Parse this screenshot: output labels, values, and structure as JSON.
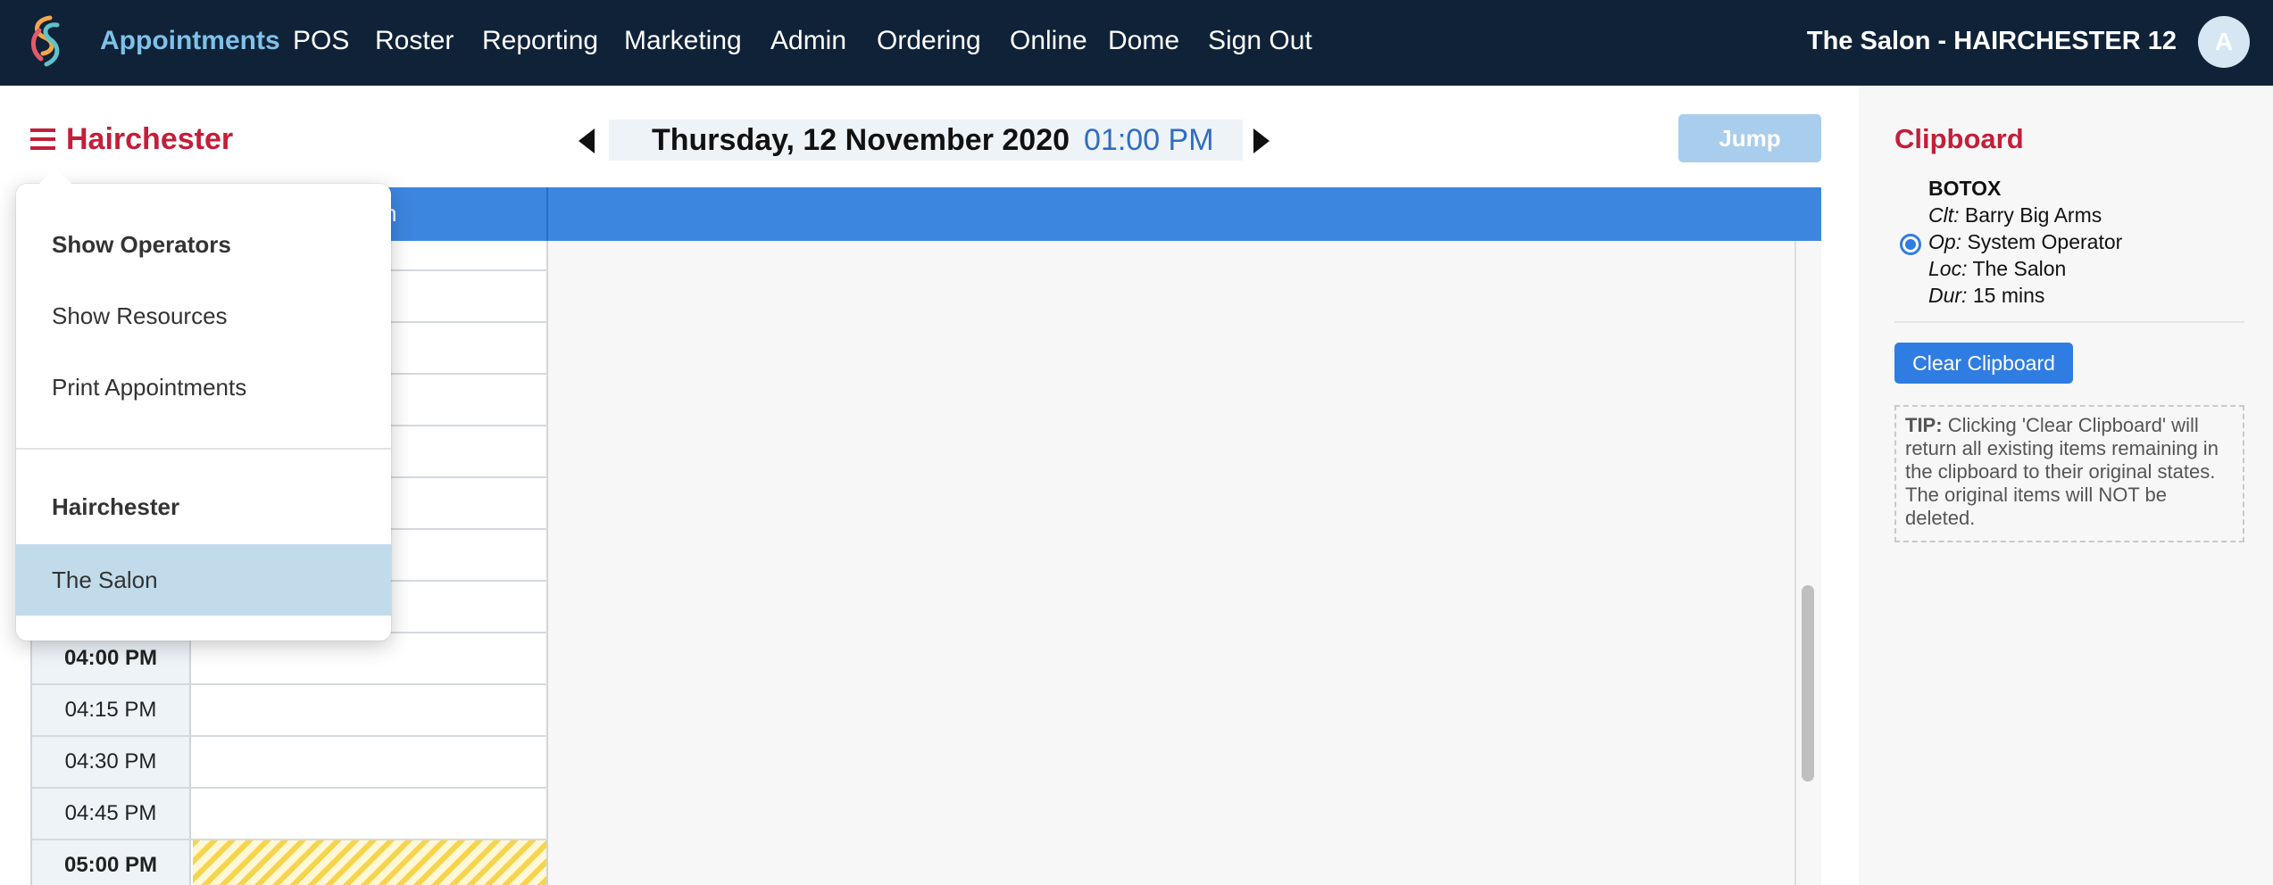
{
  "nav": {
    "items": [
      "Appointments",
      "POS",
      "Roster",
      "Reporting",
      "Marketing",
      "Admin",
      "Ordering",
      "Online",
      "Dome",
      "Sign Out"
    ],
    "active": "Appointments",
    "tenant": "The Salon - HAIRCHESTER 12",
    "avatar_initial": "A"
  },
  "location_title": "Hairchester",
  "date_nav": {
    "date": "Thursday, 12 November 2020",
    "time": "01:00 PM",
    "jump_label": "Jump"
  },
  "calendar": {
    "column_label_partial": "n",
    "time_slots": [
      {
        "label": "04:00 PM",
        "hour": true,
        "booked": false
      },
      {
        "label": "04:15 PM",
        "hour": false,
        "booked": false
      },
      {
        "label": "04:30 PM",
        "hour": false,
        "booked": false
      },
      {
        "label": "04:45 PM",
        "hour": false,
        "booked": false
      },
      {
        "label": "05:00 PM",
        "hour": true,
        "booked": true
      }
    ]
  },
  "menu": {
    "show_operators": "Show Operators",
    "show_resources": "Show Resources",
    "print_appointments": "Print Appointments",
    "section_heading": "Hairchester",
    "selected_location": "The Salon"
  },
  "clipboard": {
    "title": "Clipboard",
    "item": {
      "service": "BOTOX",
      "client_label": "Clt:",
      "client": "Barry Big Arms",
      "operator_label": "Op:",
      "operator": "System Operator",
      "location_label": "Loc:",
      "location": "The Salon",
      "duration_label": "Dur:",
      "duration": "15 mins"
    },
    "clear_label": "Clear Clipboard",
    "tip_label": "TIP:",
    "tip_text": "Clicking 'Clear Clipboard' will return all existing items remaining in the clipboard to their original states. The original items will NOT be deleted."
  },
  "colors": {
    "topbar": "#0f2238",
    "accent_red": "#c41e3a",
    "accent_blue": "#3c86e0",
    "active_nav": "#7fc1e8"
  }
}
